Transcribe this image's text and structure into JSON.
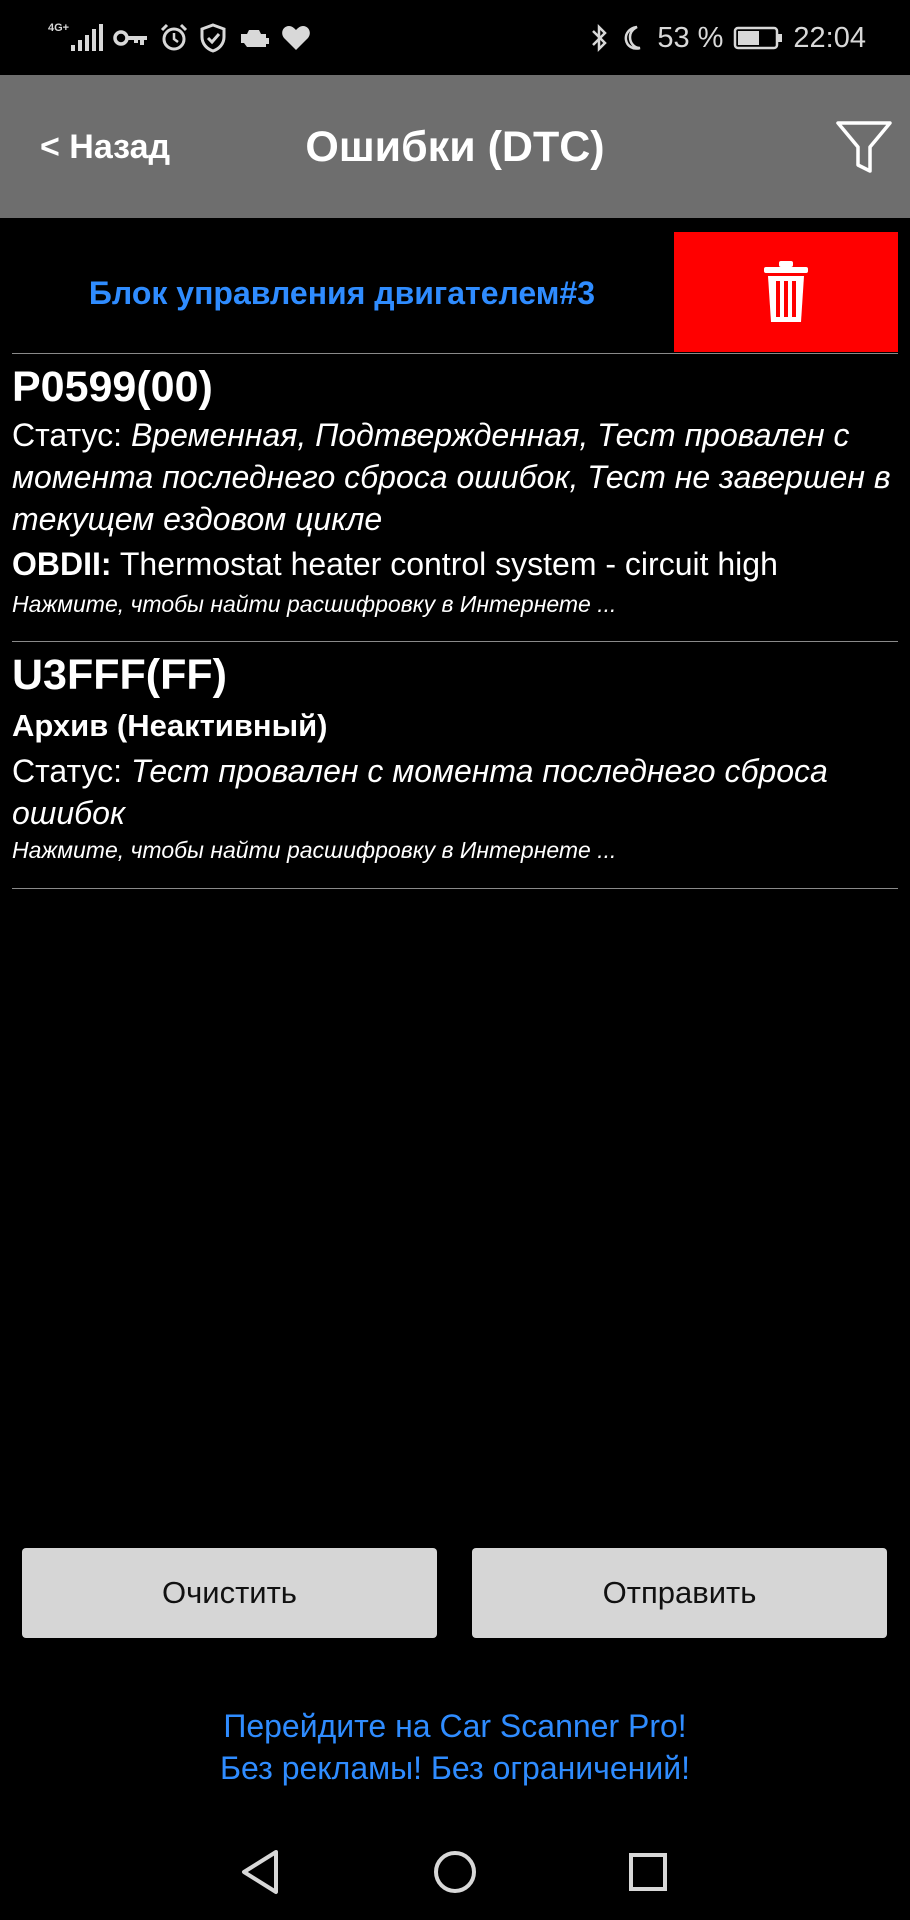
{
  "status_bar": {
    "network": "4G+",
    "battery_percent": "53 %",
    "time": "22:04",
    "left_icons": [
      "signal-icon",
      "key-icon",
      "alarm-icon",
      "shield-icon",
      "engine-icon",
      "heart-icon"
    ],
    "right_icons": [
      "bluetooth-icon",
      "moon-icon",
      "battery-icon"
    ]
  },
  "header": {
    "back_label": "< Назад",
    "title": "Ошибки (DTC)",
    "filter_icon": "filter-icon"
  },
  "ecu": {
    "label": "Блок управления двигателем#3",
    "delete_icon": "trash-icon",
    "delete_color": "#ff0000"
  },
  "dtc_list": [
    {
      "code": "P0599(00)",
      "status_label": "Статус: ",
      "status_value": "Временная, Подтвержденная, Тест провален с момента последнего сброса ошибок, Тест не завершен в текущем ездовом цикле",
      "obd_label": "OBDII:",
      "obd_value": " Thermostat heater control system - circuit high",
      "hint": "Нажмите, чтобы найти расшифровку в Интернете ..."
    },
    {
      "code": "U3FFF(FF)",
      "archive": "Архив (Неактивный)",
      "status_label": "Статус: ",
      "status_value": "Тест провален с момента последнего сброса ошибок",
      "hint": "Нажмите, чтобы найти расшифровку в Интернете ..."
    }
  ],
  "buttons": {
    "clear": "Очистить",
    "send": "Отправить"
  },
  "promo": {
    "line1": "Перейдите на Car Scanner Pro!",
    "line2": "Без рекламы! Без ограничений!",
    "color": "#2f8cff"
  },
  "nav": {
    "back_icon": "triangle-back-icon",
    "home_icon": "circle-home-icon",
    "recents_icon": "square-recents-icon"
  }
}
